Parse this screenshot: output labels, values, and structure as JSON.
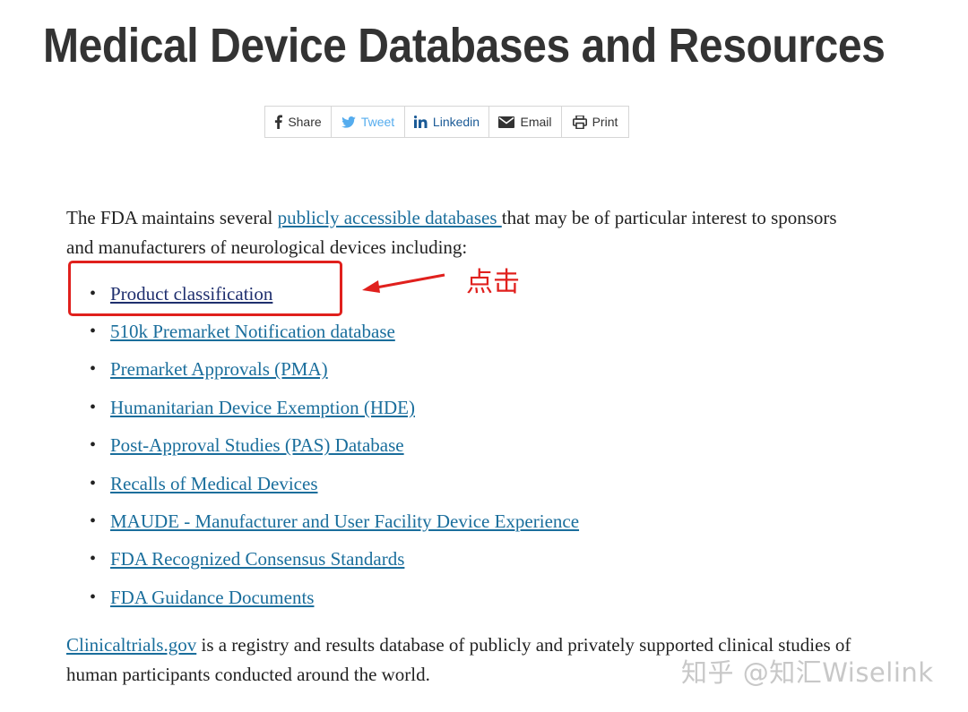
{
  "page": {
    "title": "Medical Device Databases and Resources"
  },
  "share_bar": {
    "share_label": "Share",
    "tweet_label": "Tweet",
    "linkedin_label": "Linkedin",
    "email_label": "Email",
    "print_label": "Print"
  },
  "intro": {
    "before": "The FDA maintains several ",
    "link": "publicly accessible databases ",
    "after": "that may be of particular interest to sponsors and manufacturers of neurological devices including:"
  },
  "databases": [
    "Product classification",
    "510k Premarket Notification database",
    "Premarket Approvals (PMA)",
    "Humanitarian Device Exemption (HDE)",
    "Post-Approval Studies (PAS) Database",
    "Recalls of Medical Devices",
    "MAUDE - Manufacturer and User Facility Device Experience",
    "FDA Recognized Consensus Standards",
    "FDA Guidance Documents"
  ],
  "bullet": "•",
  "footer": {
    "link": "Clinicaltrials.gov",
    "text": " is a registry and results database of publicly and privately supported clinical studies of human participants conducted around the world."
  },
  "annotation": {
    "label": "点击",
    "color": "#e0201d"
  },
  "watermark": "知乎 @知汇Wiselink",
  "colors": {
    "link": "#1a6e9c",
    "visited_link": "#1f2f6e",
    "twitter": "#55acee"
  }
}
